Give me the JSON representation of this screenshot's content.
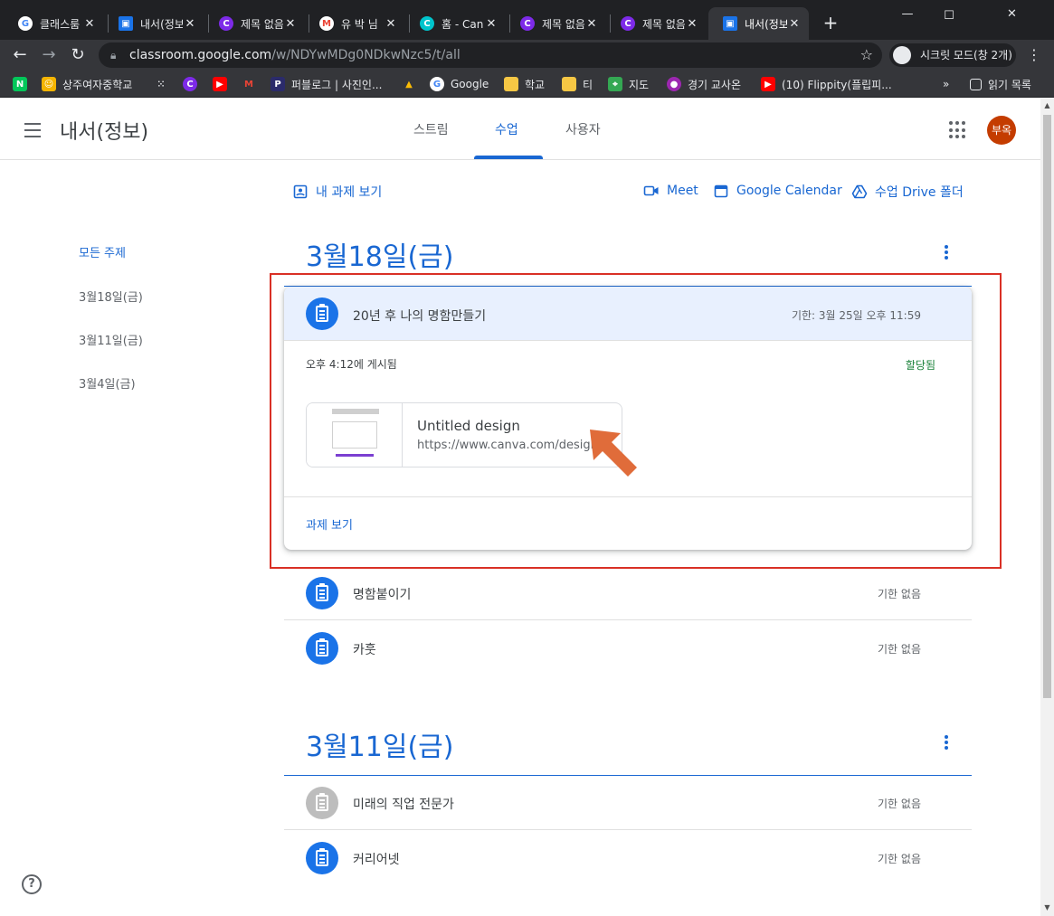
{
  "browser": {
    "tabs": [
      {
        "title": "클래스룸",
        "favicon": "google-icon",
        "color": "#ffffff"
      },
      {
        "title": "내서(정보",
        "favicon": "classroom-icon",
        "color": "#1a73e8"
      },
      {
        "title": "제목 없음",
        "favicon": "canva-icon",
        "color": "#7d2ae8"
      },
      {
        "title": "유 박 님",
        "favicon": "gmail-icon",
        "color": "#ea4335"
      },
      {
        "title": "홈 - Can",
        "favicon": "canva-icon",
        "color": "#00c4cc"
      },
      {
        "title": "제목 없음",
        "favicon": "canva-icon",
        "color": "#7d2ae8"
      },
      {
        "title": "제목 없음",
        "favicon": "canva-icon",
        "color": "#7d2ae8"
      },
      {
        "title": "내서(정보",
        "favicon": "classroom-icon",
        "color": "#1a73e8"
      }
    ],
    "url_host": "classroom.google.com",
    "url_path": "/w/NDYwMDg0NDkwNzc5/t/all",
    "incognito_label": "시크릿 모드(창 2개)",
    "bookmarks": [
      {
        "label": "",
        "icon": "naver-icon",
        "color": "#03c75a"
      },
      {
        "label": "상주여자중학교",
        "icon": "school-icon",
        "color": "#f4b400"
      },
      {
        "label": "",
        "icon": "dots-icon",
        "color": "#35363a"
      },
      {
        "label": "",
        "icon": "canva-icon",
        "color": "#7d2ae8"
      },
      {
        "label": "",
        "icon": "youtube-icon",
        "color": "#ff0000"
      },
      {
        "label": "",
        "icon": "gmail-icon",
        "color": "#ea4335"
      },
      {
        "label": "퍼블로그 | 사진인...",
        "icon": "p-icon",
        "color": "#2b2b6b"
      },
      {
        "label": "",
        "icon": "ads-icon",
        "color": "#4285f4"
      },
      {
        "label": "Google",
        "icon": "google-icon",
        "color": "#ffffff"
      },
      {
        "label": "학교",
        "icon": "folder-icon",
        "color": "#f6c744"
      },
      {
        "label": "티",
        "icon": "folder-icon",
        "color": "#f6c744"
      },
      {
        "label": "지도",
        "icon": "maps-icon",
        "color": "#34a853"
      },
      {
        "label": "경기 교사온",
        "icon": "globe-icon",
        "color": "#9c27b0"
      },
      {
        "label": "(10) Flippity(플립피...",
        "icon": "youtube-icon",
        "color": "#ff0000"
      }
    ],
    "reading_list": "읽기 목록",
    "more_bookmarks": "»"
  },
  "app": {
    "class_title": "내서(정보)",
    "nav_tabs": [
      "스트림",
      "수업",
      "사용자"
    ],
    "avatar_initials": "부옥",
    "accent": "#1967d2",
    "top_links": {
      "my_work": "내 과제 보기",
      "meet": "Meet",
      "calendar": "Google Calendar",
      "drive": "수업 Drive 폴더"
    },
    "sidebar": [
      "모든 주제",
      "3월18일(금)",
      "3월11일(금)",
      "3월4일(금)"
    ],
    "sections": [
      {
        "title": "3월18일(금)",
        "expanded": {
          "title": "20년 후 나의 명함만들기",
          "due": "기한: 3월 25일 오후 11:59",
          "posted": "오후 4:12에 게시됨",
          "status": "할당됨",
          "attachment_title": "Untitled design",
          "attachment_url": "https://www.canva.com/design",
          "view_label": "과제 보기"
        },
        "items": [
          {
            "title": "명함붙이기",
            "due": "기한 없음"
          },
          {
            "title": "카훗",
            "due": "기한 없음"
          }
        ]
      },
      {
        "title": "3월11일(금)",
        "items": [
          {
            "title": "미래의 직업 전문가",
            "due": "기한 없음"
          },
          {
            "title": "커리어넷",
            "due": "기한 없음"
          }
        ]
      }
    ],
    "help": "?"
  }
}
